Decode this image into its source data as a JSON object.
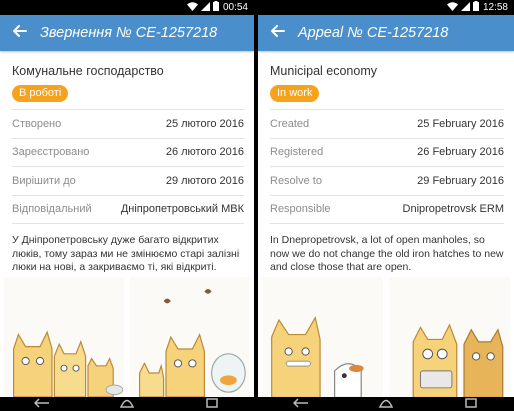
{
  "screens": {
    "left": {
      "status_time": "00:54",
      "toolbar_title": "Звернення № CE-1257218",
      "category": "Комунальне господарство",
      "status_badge": "В роботі",
      "rows": [
        {
          "label": "Створено",
          "value": "25 лютого 2016"
        },
        {
          "label": "Зареєстровано",
          "value": "26 лютого 2016"
        },
        {
          "label": "Вирішити до",
          "value": "29 лютого 2016"
        },
        {
          "label": "Відповідальний",
          "value": "Дніпропетровський МВК"
        }
      ],
      "description": "У Дніпропетровську дуже багато відкритих люків, тому зараз ми не змінюємо старі залізні люки на нові, а закриваємо ті, які відкриті."
    },
    "right": {
      "status_time": "12:58",
      "toolbar_title": "Appeal № CE-1257218",
      "category": "Municipal economy",
      "status_badge": "In work",
      "rows": [
        {
          "label": "Created",
          "value": "25 February 2016"
        },
        {
          "label": "Registered",
          "value": "26 February 2016"
        },
        {
          "label": "Resolve to",
          "value": "29 February 2016"
        },
        {
          "label": "Responsible",
          "value": "Dnipropetrovsk ERM"
        }
      ],
      "description": "In Dnepropetrovsk, a lot of open manholes, so now we do not change the old iron hatches to new and close those that are open."
    }
  },
  "icons": {
    "back": "back-arrow-icon",
    "wifi": "wifi-icon",
    "signal": "signal-icon",
    "battery": "battery-icon",
    "nav_back": "nav-back-icon",
    "nav_home": "nav-home-icon",
    "nav_recents": "nav-recents-icon"
  },
  "colors": {
    "toolbar": "#4a8fcb",
    "badge": "#f7a21c",
    "statusbar": "#000000"
  }
}
